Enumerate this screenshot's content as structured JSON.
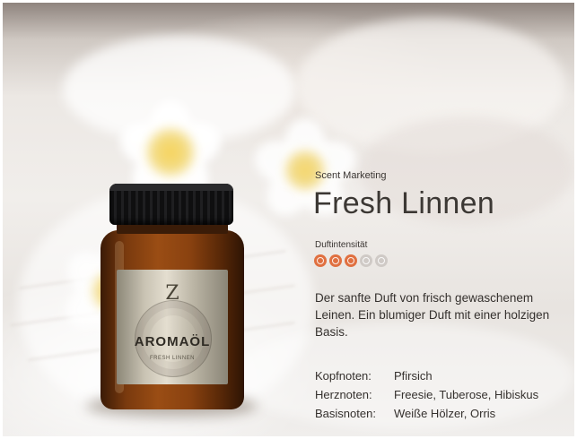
{
  "product": {
    "eyebrow": "Scent Marketing",
    "title": "Fresh Linnen",
    "intensity_label": "Duftintensität",
    "intensity": {
      "value": 3,
      "max": 5,
      "on_color": "#e07040",
      "off_color": "#cfcac6"
    },
    "description": "Der sanfte Duft von frisch gewaschenem Leinen. Ein blumiger Duft mit einer holzigen Basis.",
    "notes": [
      {
        "key": "Kopfnoten:",
        "value": "Pfirsich"
      },
      {
        "key": "Herznoten:",
        "value": "Freesie, Tuberose, Hibiskus"
      },
      {
        "key": "Basisnoten:",
        "value": "Weiße Hölzer, Orris"
      }
    ]
  },
  "jar": {
    "logo": "Z",
    "brand": "AROMAÖL",
    "brand_sub": "FRESH LINNEN"
  },
  "icons": [
    "intensity-flower-icon"
  ]
}
